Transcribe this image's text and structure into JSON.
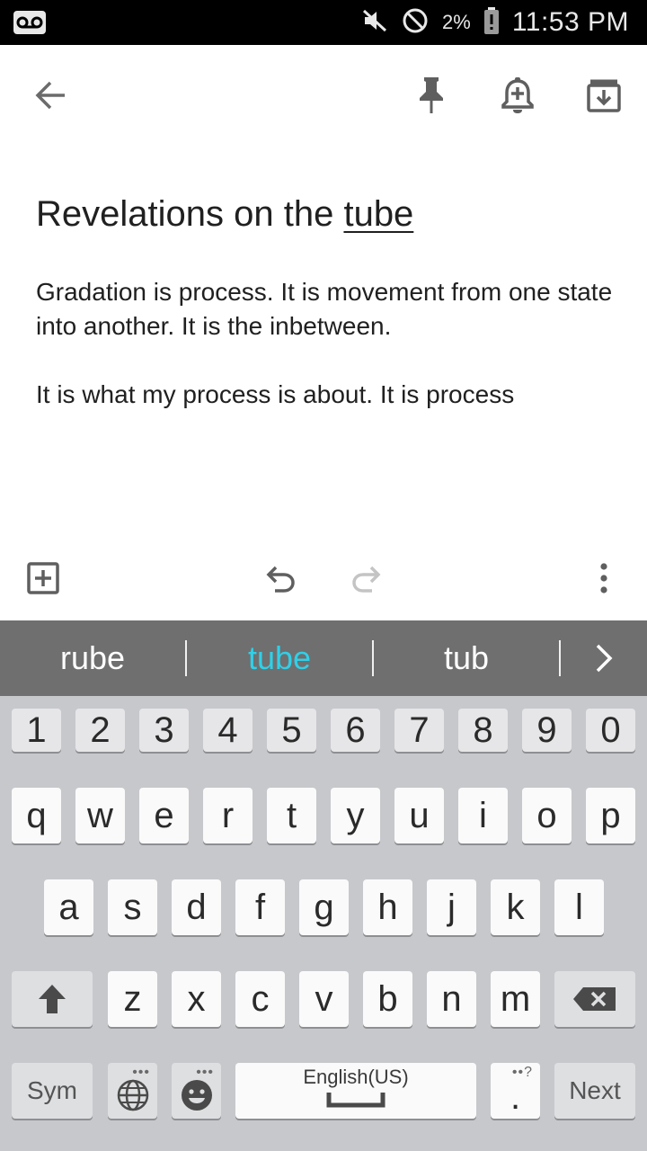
{
  "status_bar": {
    "battery_percent": "2%",
    "time": "11:53 PM",
    "icons": [
      "voicemail-icon",
      "mute-icon",
      "blocked-icon",
      "battery-alert-icon"
    ]
  },
  "app_bar": {
    "icons": [
      "back-arrow-icon",
      "pin-icon",
      "reminder-bell-icon",
      "archive-icon"
    ]
  },
  "note": {
    "title_prefix": "Revelations on the ",
    "title_word": "tube",
    "paragraphs": [
      "Gradation is process. It is movement from one state into another. It is the inbetween.",
      "It is what my process is about. It is process"
    ]
  },
  "editor_toolbar": {
    "icons": [
      "add-box-icon",
      "undo-icon",
      "redo-icon",
      "more-vert-icon"
    ]
  },
  "suggestions": {
    "items": [
      "rube",
      "tube",
      "tub"
    ],
    "active_index": 1,
    "active_color": "#2fd0e8"
  },
  "keyboard": {
    "number_row": [
      "1",
      "2",
      "3",
      "4",
      "5",
      "6",
      "7",
      "8",
      "9",
      "0"
    ],
    "row1": [
      "q",
      "w",
      "e",
      "r",
      "t",
      "y",
      "u",
      "i",
      "o",
      "p"
    ],
    "row2": [
      "a",
      "s",
      "d",
      "f",
      "g",
      "h",
      "j",
      "k",
      "l"
    ],
    "row3": [
      "z",
      "x",
      "c",
      "v",
      "b",
      "n",
      "m"
    ],
    "sym_label": "Sym",
    "space_label": "English(US)",
    "period_label": ".",
    "period_sub": "••?",
    "next_label": "Next",
    "dots_sub": "•••"
  }
}
